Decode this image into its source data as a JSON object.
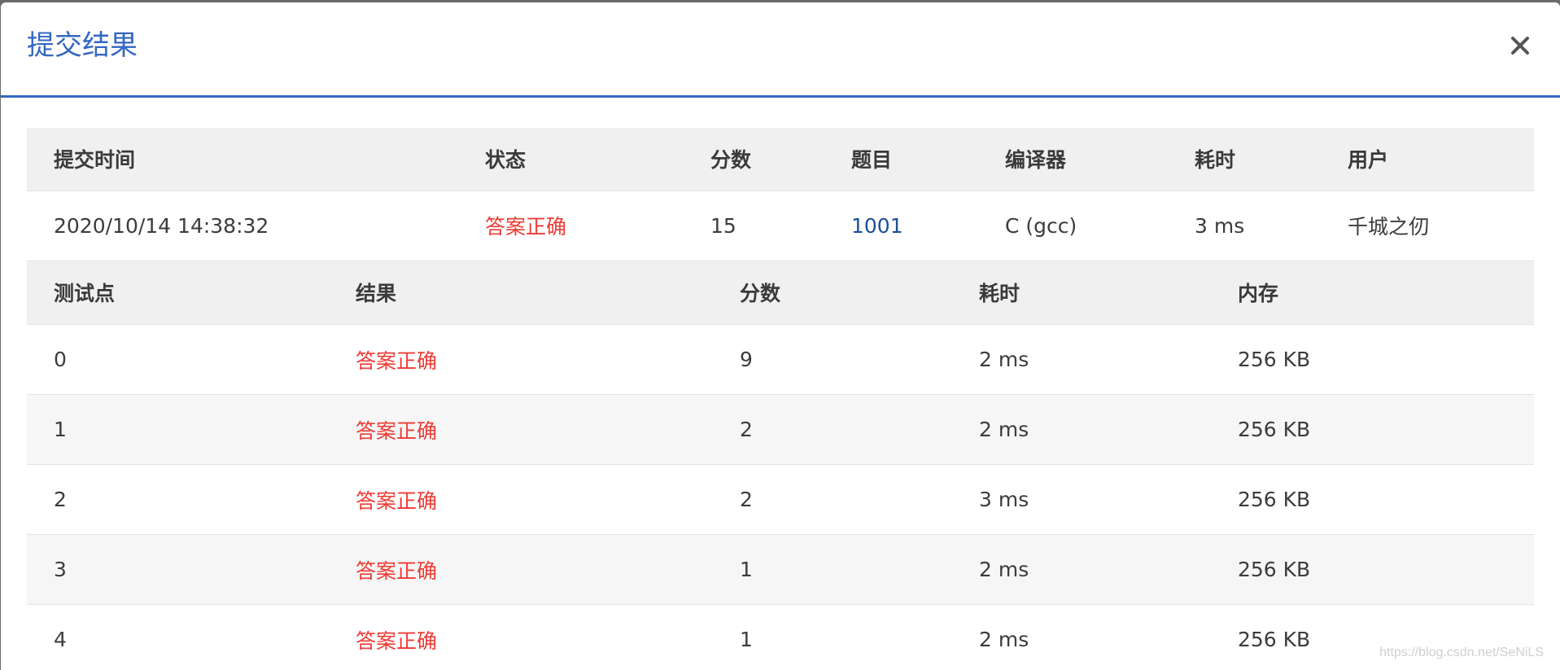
{
  "modal": {
    "title": "提交结果",
    "close_icon": "close-icon"
  },
  "summary": {
    "headers": [
      "提交时间",
      "状态",
      "分数",
      "题目",
      "编译器",
      "耗时",
      "用户"
    ],
    "row": {
      "time": "2020/10/14 14:38:32",
      "status": "答案正确",
      "score": "15",
      "problem": "1001",
      "compiler": "C (gcc)",
      "duration": "3 ms",
      "user": "千城之仞"
    }
  },
  "tests": {
    "headers": [
      "测试点",
      "结果",
      "分数",
      "耗时",
      "内存"
    ],
    "rows": [
      {
        "point": "0",
        "result": "答案正确",
        "score": "9",
        "time": "2 ms",
        "memory": "256 KB"
      },
      {
        "point": "1",
        "result": "答案正确",
        "score": "2",
        "time": "2 ms",
        "memory": "256 KB"
      },
      {
        "point": "2",
        "result": "答案正确",
        "score": "2",
        "time": "3 ms",
        "memory": "256 KB"
      },
      {
        "point": "3",
        "result": "答案正确",
        "score": "1",
        "time": "2 ms",
        "memory": "256 KB"
      },
      {
        "point": "4",
        "result": "答案正确",
        "score": "1",
        "time": "2 ms",
        "memory": "256 KB"
      }
    ]
  },
  "watermark": "https://blog.csdn.net/SeNiLS",
  "colors": {
    "accent": "#3467c2",
    "status_ok": "#ee3b34",
    "link": "#1c4f9a"
  }
}
